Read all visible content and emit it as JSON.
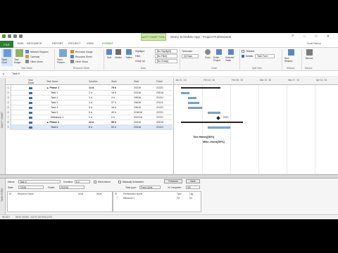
{
  "window": {
    "title": "Demo Schedule.mpp - Project Professional",
    "context_tab": "GANTT CHART TOOLS",
    "user": "Scott Nancy",
    "controls": "? ─ □ ✕"
  },
  "tabs": {
    "file": "FILE",
    "items": [
      "TASK",
      "RESOURCE",
      "REPORT",
      "PROJECT",
      "VIEW",
      "FORMAT"
    ]
  },
  "ribbon": {
    "gantt_chart": "Gantt Chart",
    "task_usage": "Task Usage",
    "network_diagram": "Network Diagram",
    "calendar": "Calendar",
    "other_views": "Other Views",
    "team_planner": "Team Planner",
    "resource_usage": "Resource Usage",
    "resource_sheet": "Resource Sheet",
    "other_views2": "Other Views",
    "sort": "Sort",
    "outline": "Outline",
    "tables": "Tables",
    "highlight_label": "Highlight:",
    "highlight_val": "[No Highlight]",
    "filter_label": "Filter:",
    "filter_val": "[No Filter]",
    "group_label": "Group by:",
    "group_val": "[No Group]",
    "timescale_label": "Timescale:",
    "timescale_val": "[4] Days",
    "zoom": "Zoom",
    "entire_project": "Entire Project",
    "selected_tasks": "Selected Tasks",
    "timeline_label": "Timeline",
    "details_label": "Details",
    "details_val": "Task Form",
    "new_window": "New Window",
    "macros": "Macros",
    "groups": {
      "task_views": "Task Views",
      "resource_views": "Resource Views",
      "data": "Data",
      "zoom": "Zoom",
      "split_view": "Split View",
      "window": "Window",
      "macros": "Macros"
    }
  },
  "entry_bar": {
    "value": "Task 6",
    "cancel": "✕"
  },
  "view_bar": {
    "gantt": "GANTT CHART",
    "form": "TASK FORM"
  },
  "grid": {
    "headers": {
      "mode": "Task Mode",
      "name": "Task Name",
      "duration": "Duration",
      "work": "Work",
      "start": "Start",
      "finish": "Finish"
    },
    "rows": [
      {
        "id": "1",
        "name": "▲ Phase 1",
        "duration": "14 d",
        "work": "79 h",
        "start": "2/3/16",
        "finish": "2/22/1",
        "summary": true,
        "indent": 0
      },
      {
        "id": "2",
        "name": "Task 1",
        "duration": "3 d",
        "work": "16 h",
        "start": "2/3/16",
        "finish": "2/5/16",
        "summary": false,
        "indent": 1
      },
      {
        "id": "3",
        "name": "Task 2",
        "duration": "3 d",
        "work": "4 h",
        "start": "2/8/16",
        "finish": "2/10/1",
        "summary": false,
        "indent": 1
      },
      {
        "id": "4",
        "name": "Task 3",
        "duration": "4 d",
        "work": "27 h",
        "start": "2/8/16",
        "finish": "2/11/1",
        "summary": false,
        "indent": 1
      },
      {
        "id": "5",
        "name": "Task 4",
        "duration": "5 d",
        "work": "16 h",
        "start": "2/8/16",
        "finish": "2/12/1",
        "summary": false,
        "indent": 1
      },
      {
        "id": "6",
        "name": "Task 5",
        "duration": "5 d",
        "work": "40 h",
        "start": "2/16/16",
        "finish": "2/22/1",
        "summary": false,
        "indent": 1
      },
      {
        "id": "7",
        "name": "Milestone 1",
        "duration": "0 d",
        "work": "0 h",
        "start": "2/22/16",
        "finish": "2/22/1",
        "summary": false,
        "indent": 1
      },
      {
        "id": "8",
        "name": "▲ Phase 2",
        "duration": "22 d",
        "work": "58 h",
        "start": "2/3/16",
        "finish": "3/3/16",
        "summary": true,
        "indent": 0
      },
      {
        "id": "9",
        "name": "Task 6",
        "duration": "8 d",
        "work": "53 h",
        "start": "2/3/16",
        "finish": "2/12/1",
        "summary": false,
        "indent": 1,
        "selected": true
      }
    ]
  },
  "gantt": {
    "weeks": [
      "Jan 31, '16",
      "Feb 14, '16",
      "Feb 28, '16",
      "Mar 13, '16",
      "Mar 27, '16",
      "Apr 10, '16"
    ],
    "labels": {
      "tom": "Tom Haney[50%]",
      "mike": "Mike Jones[50%]",
      "milestone": "2/22"
    }
  },
  "task_form": {
    "name_label": "Name:",
    "name_val": "Task 6",
    "duration_label": "Duration:",
    "duration_val": "8 d",
    "effort_label": "Effort driven",
    "manual_label": "Manually Scheduled",
    "previous": "Previous",
    "next": "Next",
    "start_label": "Start:",
    "start_val": "2/3/16",
    "finish_label": "Finish:",
    "finish_val": "2/12/16",
    "task_type_label": "Task type:",
    "task_type_val": "Fixed Units",
    "complete_label": "% Complete:",
    "complete_val": "0%",
    "res_headers": {
      "id": "ID",
      "name": "Resource Name",
      "units": "Units",
      "work": "Work"
    },
    "pred_headers": {
      "id": "ID",
      "name": "Predecessor Name",
      "type": "Type",
      "lag": "Lag"
    },
    "pred_rows": [
      {
        "id": "7",
        "name": "Milestone 1",
        "type": "FS",
        "lag": "0d"
      }
    ]
  },
  "status": {
    "ready": "READY",
    "mode": "NEW TASKS : AUTO SCHEDULED"
  }
}
